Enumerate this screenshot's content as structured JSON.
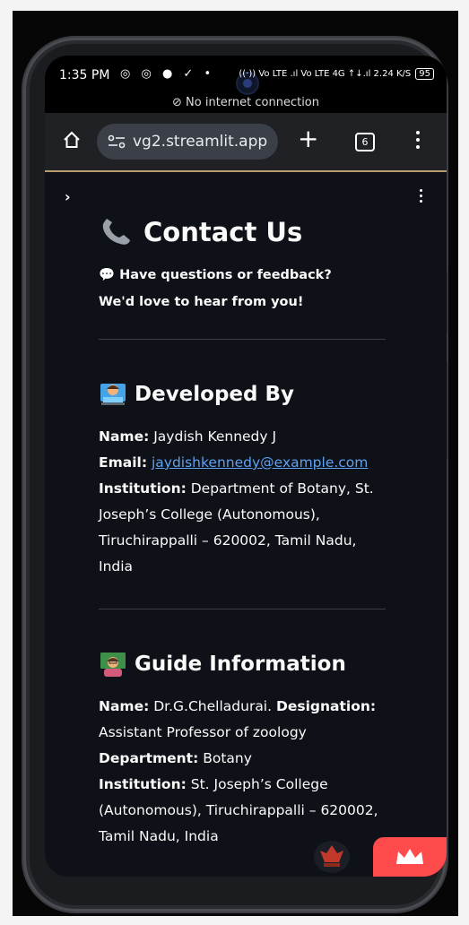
{
  "status_bar": {
    "time": "1:35 PM",
    "icons": "◎ ◎ ● ✓ •",
    "right_icons": "((·)) Vo LTE .ıl Vo LTE 4G ↑↓.ıl 2.24 K/S",
    "battery": "95",
    "no_internet": "No internet connection"
  },
  "browser": {
    "url": "vg2.streamlit.app",
    "tab_count": "6",
    "new_tab_label": "+"
  },
  "page": {
    "title": "Contact Us",
    "intro_line1": "Have questions or feedback?",
    "intro_line2": "We'd love to hear from you!",
    "developer": {
      "heading": "Developed By",
      "name_label": "Name:",
      "name": "Jaydish Kennedy J",
      "email_label": "Email:",
      "email": "jaydishkennedy@example.com",
      "institution_label": "Institution:",
      "institution": "Department of Botany, St. Joseph’s College (Autonomous), Tiruchirappalli – 620002, Tamil Nadu, India"
    },
    "guide": {
      "heading": "Guide Information",
      "name_label": "Name:",
      "name": "Dr.G.Chelladurai.",
      "designation_label": "Designation:",
      "designation": "Assistant Professor of zoology",
      "department_label": "Department:",
      "department": "Botany",
      "institution_label": "Institution:",
      "institution": "St. Joseph’s College (Autonomous), Tiruchirappalli – 620002, Tamil Nadu, India"
    }
  },
  "colors": {
    "app_bg": "#0e1117",
    "text": "#fafafa",
    "link": "#5da1f0",
    "streamlit_badge": "#ff4b4b",
    "browser_bar": "#202124"
  }
}
